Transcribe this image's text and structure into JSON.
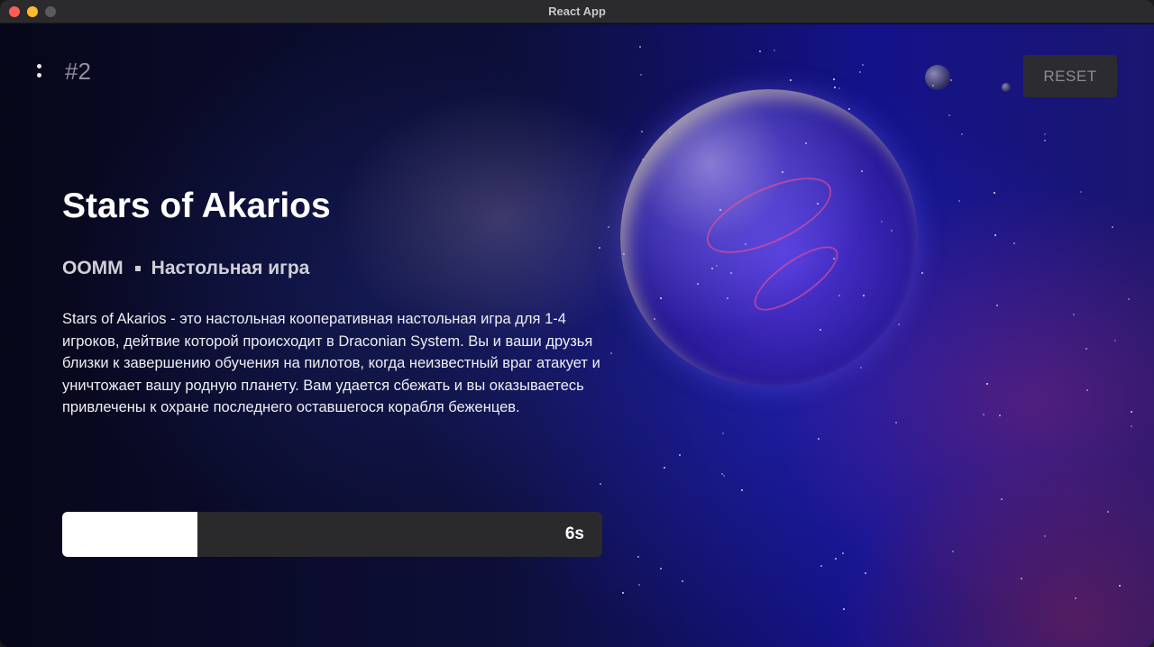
{
  "window": {
    "title": "React App"
  },
  "header": {
    "menu_icon": "more-vertical-icon",
    "rank": "#2",
    "reset_label": "RESET"
  },
  "game": {
    "title": "Stars of Akarios",
    "publisher": "OOMM",
    "category": "Настольная игра",
    "description": "Stars of Akarios - это настольная кооперативная настольная игра для 1-4 игроков, дейтвие которой происходит в Draconian System. Вы и ваши друзья близки к завершению обучения на пилотов, когда неизвестный враг атакует и уничтожает вашу родную планету. Вам удается сбежать и вы оказываетесь привлечены к охране последнего оставшегося корабля беженцев."
  },
  "timer": {
    "label": "6s",
    "progress": 0.25
  },
  "colors": {
    "accent": "#ffffff",
    "bar_bg": "#2a2a2d",
    "button_bg": "#2c2c30"
  }
}
